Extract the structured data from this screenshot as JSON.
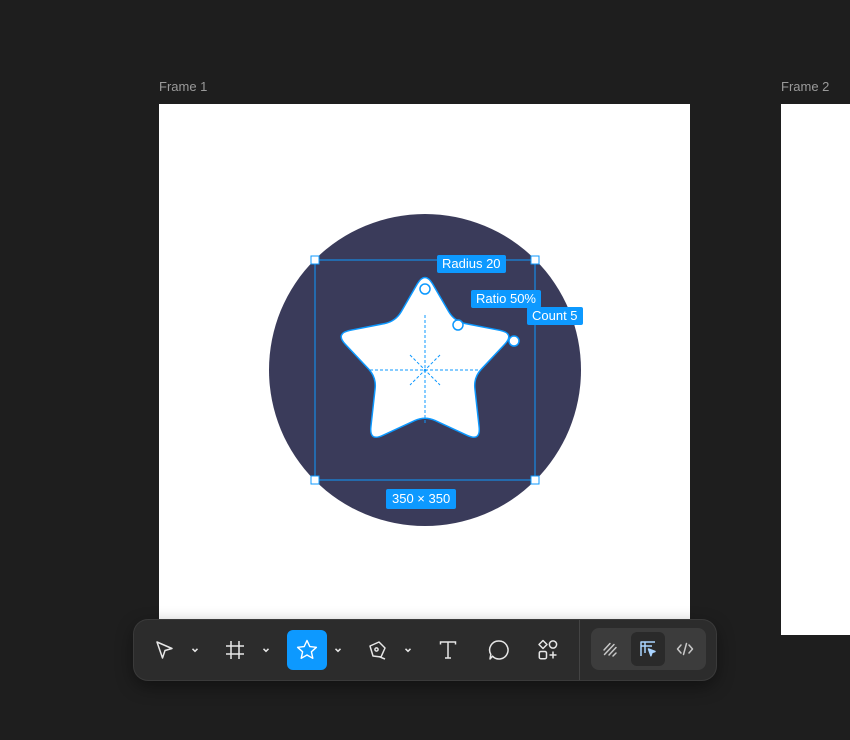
{
  "canvas": {
    "frames": [
      {
        "label": "Frame 1"
      },
      {
        "label": "Frame 2"
      }
    ]
  },
  "star_tool": {
    "radius_label": "Radius 20",
    "ratio_label": "Ratio 50%",
    "count_label": "Count 5",
    "size_label": "350 × 350"
  },
  "toolbar": {
    "tools": [
      {
        "name": "move",
        "icon": "cursor-icon"
      },
      {
        "name": "frame",
        "icon": "frame-hash-icon"
      },
      {
        "name": "shape",
        "icon": "star-icon",
        "active": true
      },
      {
        "name": "pen",
        "icon": "pen-icon"
      },
      {
        "name": "text",
        "icon": "text-icon"
      },
      {
        "name": "comment",
        "icon": "comment-icon"
      },
      {
        "name": "actions",
        "icon": "shapes-plus-icon"
      }
    ],
    "modes": [
      {
        "name": "draw",
        "icon": "draw-icon"
      },
      {
        "name": "design",
        "icon": "design-icon",
        "selected": true
      },
      {
        "name": "dev",
        "icon": "code-icon"
      }
    ]
  },
  "colors": {
    "accent": "#0d99ff",
    "canvas_bg": "#1e1e1e",
    "circle": "#3a3b5a",
    "toolbar_bg": "#2c2c2c"
  }
}
